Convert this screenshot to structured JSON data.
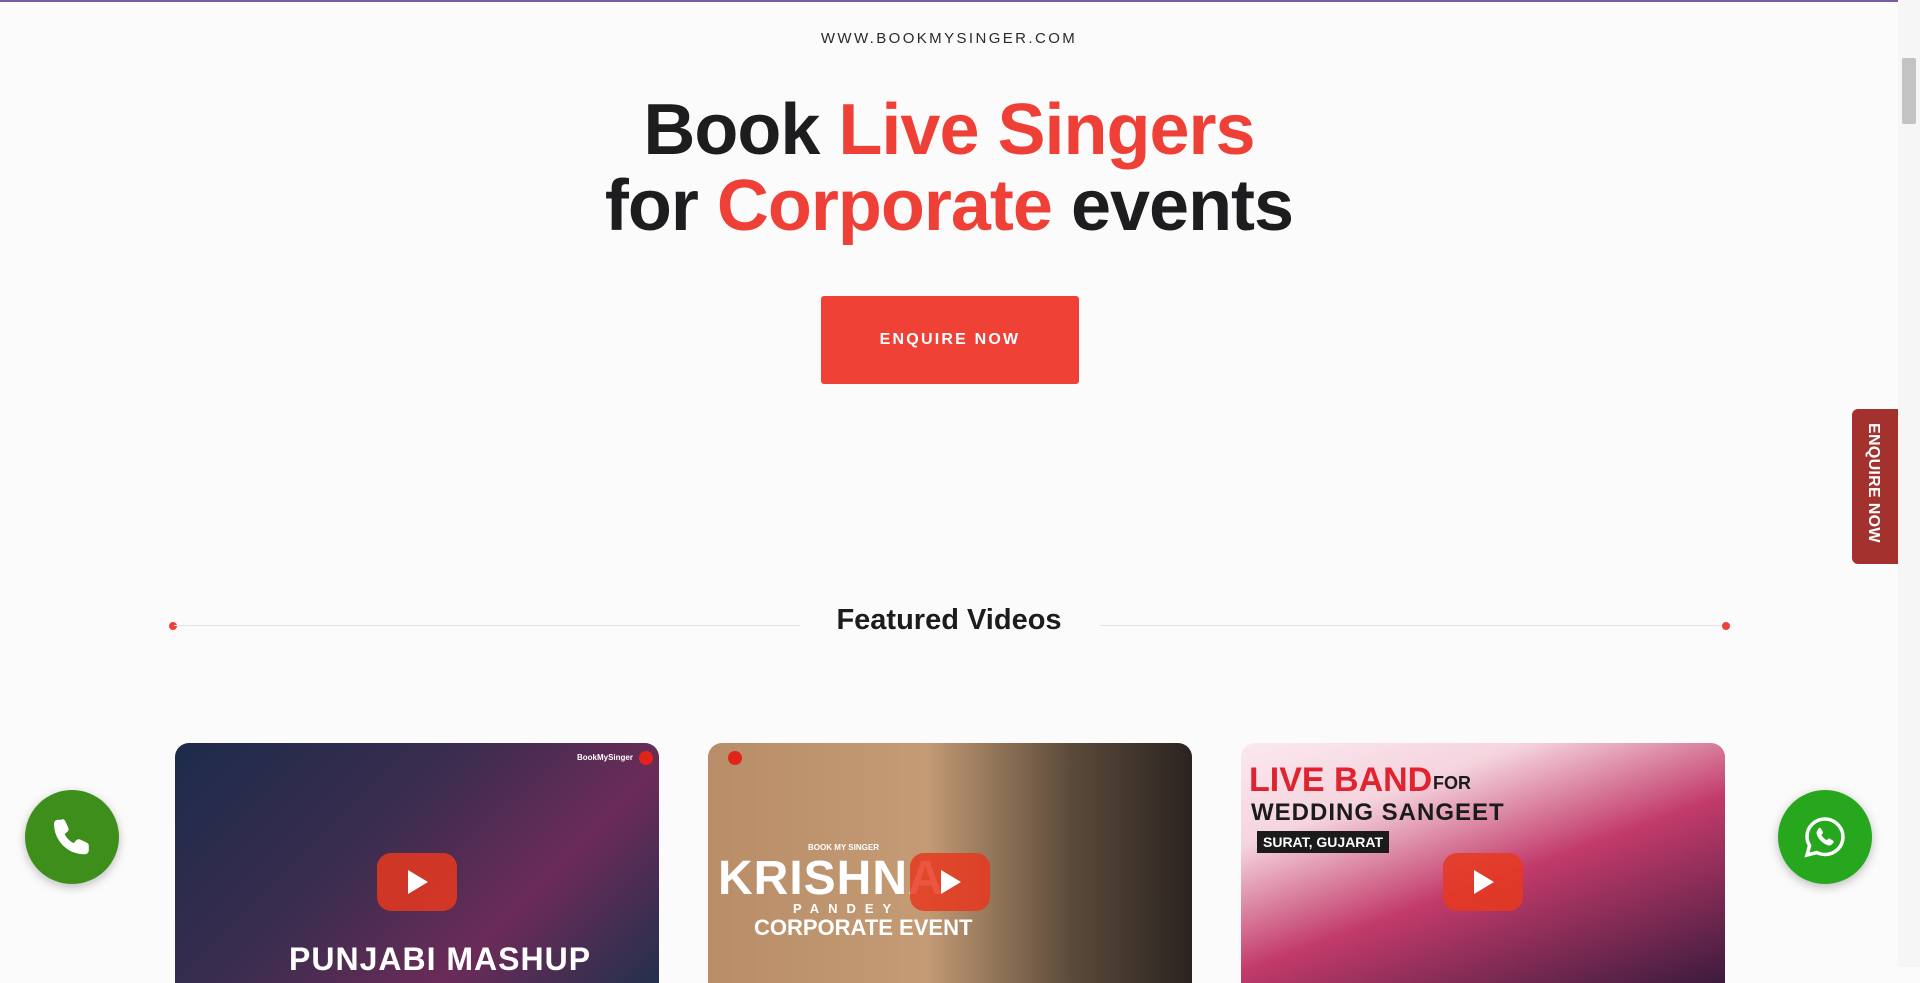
{
  "site": {
    "url": "WWW.BOOKMYSINGER.COM"
  },
  "hero": {
    "line1_plain": "Book ",
    "line1_accent": "Live Singers",
    "line2_plain_start": "for ",
    "line2_accent": "Corporate",
    "line2_plain_end": " events",
    "cta_label": "ENQUIRE NOW"
  },
  "featured": {
    "heading": "Featured Videos"
  },
  "videos": [
    {
      "thumb_text": "PUNJABI MASHUP",
      "brand": "BookMySinger"
    },
    {
      "thumb_text_top": "BOOK MY SINGER",
      "thumb_text_main": "KRISHNA",
      "thumb_text_sub": "PANDEY",
      "thumb_text_bottom": "CORPORATE EVENT"
    },
    {
      "thumb_text_line1": "LIVE BAND",
      "thumb_text_for": "FOR",
      "thumb_text_line2": "WEDDING SANGEET",
      "thumb_location": "SURAT, GUJARAT"
    }
  ],
  "side_tab": {
    "label": "ENQUIRE NOW"
  },
  "icons": {
    "call": "phone-icon",
    "whatsapp": "whatsapp-icon",
    "play": "play-icon"
  },
  "colors": {
    "accent": "#ee4036",
    "cta": "#f04137",
    "side_tab": "#a3312d",
    "call_fab": "#3e8e1c",
    "whatsapp_fab": "#27a71e"
  }
}
